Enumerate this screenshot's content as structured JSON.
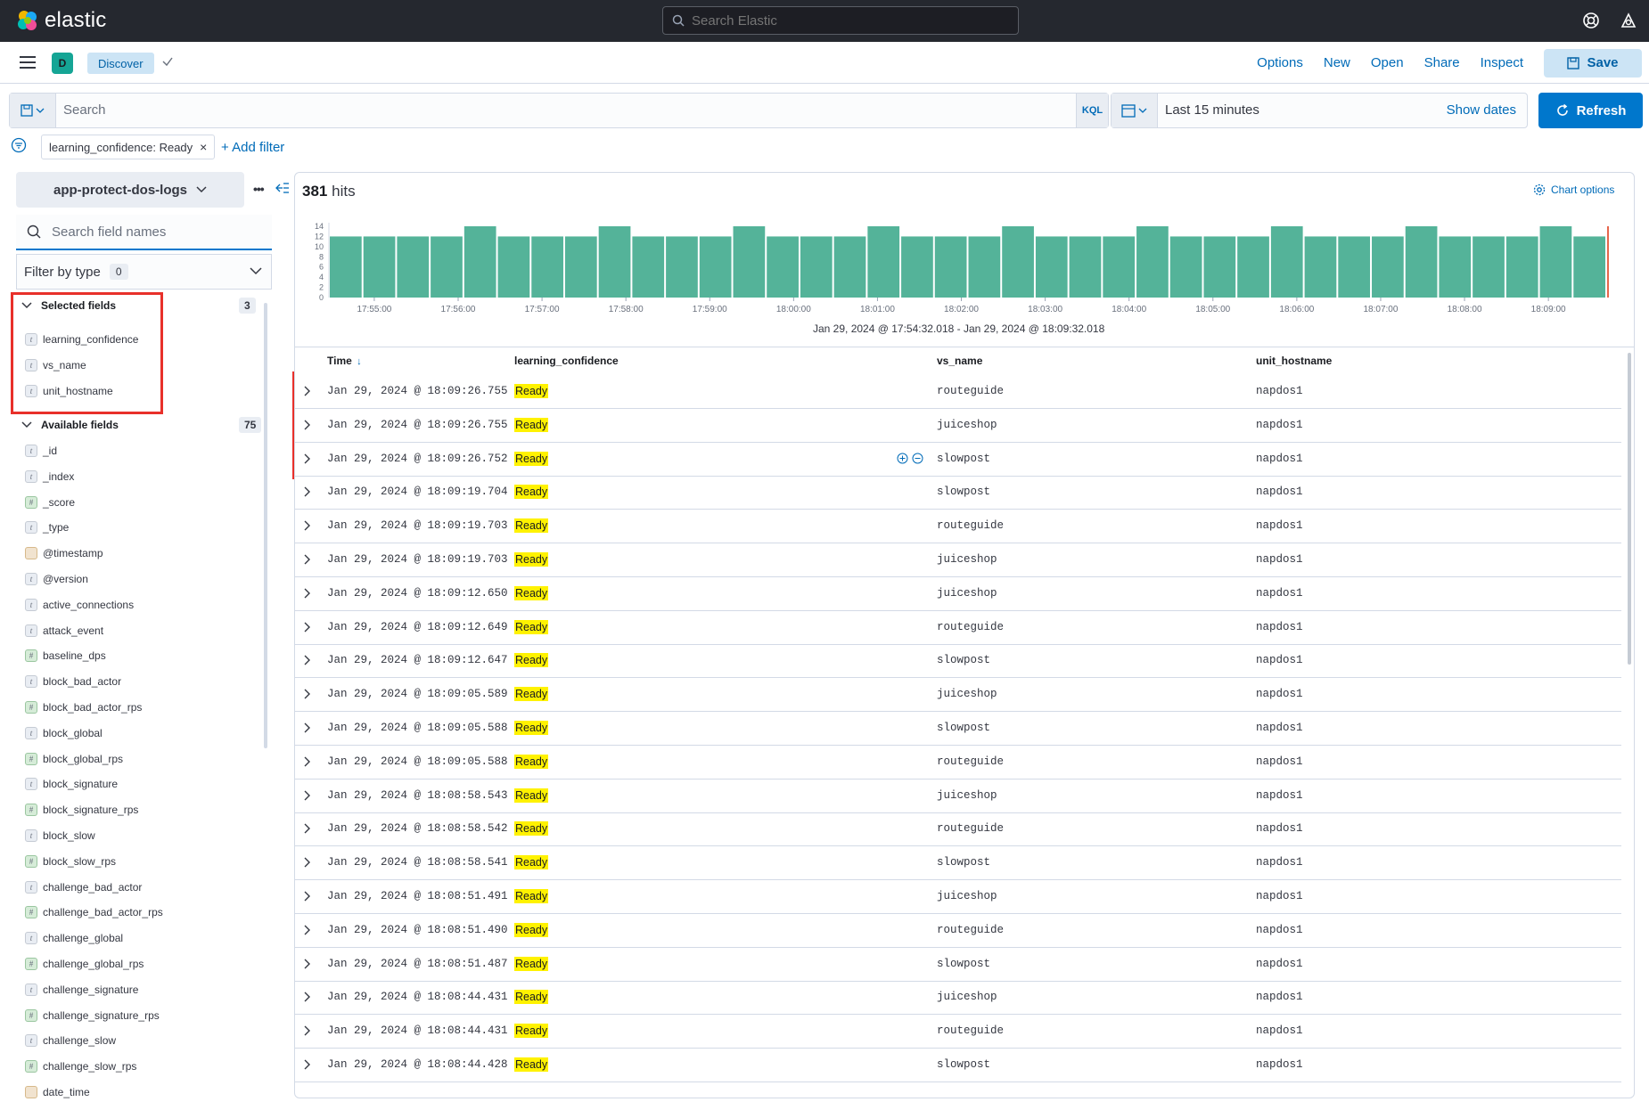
{
  "header": {
    "logo_text": "elastic",
    "search_placeholder": "Search Elastic"
  },
  "appbar": {
    "space_initial": "D",
    "breadcrumb": "Discover",
    "links": [
      "Options",
      "New",
      "Open",
      "Share",
      "Inspect"
    ],
    "save_label": "Save"
  },
  "query": {
    "placeholder": "Search",
    "language": "KQL",
    "time_range": "Last 15 minutes",
    "show_dates": "Show dates",
    "refresh_label": "Refresh"
  },
  "filters": {
    "pill": "learning_confidence: Ready",
    "add_filter": "+ Add filter"
  },
  "sidebar": {
    "index_pattern": "app-protect-dos-logs",
    "field_search_placeholder": "Search field names",
    "filter_by_type": "Filter by type",
    "filter_count": "0",
    "selected_title": "Selected fields",
    "selected_count": "3",
    "selected_fields": [
      {
        "type": "t",
        "name": "learning_confidence"
      },
      {
        "type": "t",
        "name": "vs_name"
      },
      {
        "type": "t",
        "name": "unit_hostname"
      }
    ],
    "available_title": "Available fields",
    "available_count": "75",
    "available_fields": [
      {
        "type": "t",
        "name": "_id"
      },
      {
        "type": "t",
        "name": "_index"
      },
      {
        "type": "#",
        "name": "_score"
      },
      {
        "type": "t",
        "name": "_type"
      },
      {
        "type": "date",
        "name": "@timestamp"
      },
      {
        "type": "t",
        "name": "@version"
      },
      {
        "type": "t",
        "name": "active_connections"
      },
      {
        "type": "t",
        "name": "attack_event"
      },
      {
        "type": "#",
        "name": "baseline_dps"
      },
      {
        "type": "t",
        "name": "block_bad_actor"
      },
      {
        "type": "#",
        "name": "block_bad_actor_rps"
      },
      {
        "type": "t",
        "name": "block_global"
      },
      {
        "type": "#",
        "name": "block_global_rps"
      },
      {
        "type": "t",
        "name": "block_signature"
      },
      {
        "type": "#",
        "name": "block_signature_rps"
      },
      {
        "type": "t",
        "name": "block_slow"
      },
      {
        "type": "#",
        "name": "block_slow_rps"
      },
      {
        "type": "t",
        "name": "challenge_bad_actor"
      },
      {
        "type": "#",
        "name": "challenge_bad_actor_rps"
      },
      {
        "type": "t",
        "name": "challenge_global"
      },
      {
        "type": "#",
        "name": "challenge_global_rps"
      },
      {
        "type": "t",
        "name": "challenge_signature"
      },
      {
        "type": "#",
        "name": "challenge_signature_rps"
      },
      {
        "type": "t",
        "name": "challenge_slow"
      },
      {
        "type": "#",
        "name": "challenge_slow_rps"
      },
      {
        "type": "date",
        "name": "date_time"
      }
    ]
  },
  "main": {
    "hits_count": "381",
    "hits_label": "hits",
    "chart_options": "Chart options",
    "range_text": "Jan 29, 2024 @ 17:54:32.018 - Jan 29, 2024 @ 18:09:32.018",
    "columns": [
      "Time",
      "learning_confidence",
      "vs_name",
      "unit_hostname"
    ],
    "rows": [
      {
        "time": "Jan 29, 2024 @ 18:09:26.755",
        "lc": "Ready",
        "vs": "routeguide",
        "host": "napdos1"
      },
      {
        "time": "Jan 29, 2024 @ 18:09:26.755",
        "lc": "Ready",
        "vs": "juiceshop",
        "host": "napdos1"
      },
      {
        "time": "Jan 29, 2024 @ 18:09:26.752",
        "lc": "Ready",
        "vs": "slowpost",
        "host": "napdos1"
      },
      {
        "time": "Jan 29, 2024 @ 18:09:19.704",
        "lc": "Ready",
        "vs": "slowpost",
        "host": "napdos1"
      },
      {
        "time": "Jan 29, 2024 @ 18:09:19.703",
        "lc": "Ready",
        "vs": "routeguide",
        "host": "napdos1"
      },
      {
        "time": "Jan 29, 2024 @ 18:09:19.703",
        "lc": "Ready",
        "vs": "juiceshop",
        "host": "napdos1"
      },
      {
        "time": "Jan 29, 2024 @ 18:09:12.650",
        "lc": "Ready",
        "vs": "juiceshop",
        "host": "napdos1"
      },
      {
        "time": "Jan 29, 2024 @ 18:09:12.649",
        "lc": "Ready",
        "vs": "routeguide",
        "host": "napdos1"
      },
      {
        "time": "Jan 29, 2024 @ 18:09:12.647",
        "lc": "Ready",
        "vs": "slowpost",
        "host": "napdos1"
      },
      {
        "time": "Jan 29, 2024 @ 18:09:05.589",
        "lc": "Ready",
        "vs": "juiceshop",
        "host": "napdos1"
      },
      {
        "time": "Jan 29, 2024 @ 18:09:05.588",
        "lc": "Ready",
        "vs": "slowpost",
        "host": "napdos1"
      },
      {
        "time": "Jan 29, 2024 @ 18:09:05.588",
        "lc": "Ready",
        "vs": "routeguide",
        "host": "napdos1"
      },
      {
        "time": "Jan 29, 2024 @ 18:08:58.543",
        "lc": "Ready",
        "vs": "juiceshop",
        "host": "napdos1"
      },
      {
        "time": "Jan 29, 2024 @ 18:08:58.542",
        "lc": "Ready",
        "vs": "routeguide",
        "host": "napdos1"
      },
      {
        "time": "Jan 29, 2024 @ 18:08:58.541",
        "lc": "Ready",
        "vs": "slowpost",
        "host": "napdos1"
      },
      {
        "time": "Jan 29, 2024 @ 18:08:51.491",
        "lc": "Ready",
        "vs": "juiceshop",
        "host": "napdos1"
      },
      {
        "time": "Jan 29, 2024 @ 18:08:51.490",
        "lc": "Ready",
        "vs": "routeguide",
        "host": "napdos1"
      },
      {
        "time": "Jan 29, 2024 @ 18:08:51.487",
        "lc": "Ready",
        "vs": "slowpost",
        "host": "napdos1"
      },
      {
        "time": "Jan 29, 2024 @ 18:08:44.431",
        "lc": "Ready",
        "vs": "juiceshop",
        "host": "napdos1"
      },
      {
        "time": "Jan 29, 2024 @ 18:08:44.431",
        "lc": "Ready",
        "vs": "routeguide",
        "host": "napdos1"
      },
      {
        "time": "Jan 29, 2024 @ 18:08:44.428",
        "lc": "Ready",
        "vs": "slowpost",
        "host": "napdos1"
      }
    ]
  },
  "chart_data": {
    "type": "bar",
    "title": "",
    "xlabel": "",
    "ylabel": "",
    "ylim": [
      0,
      14
    ],
    "yticks": [
      0,
      2,
      4,
      6,
      8,
      10,
      12,
      14
    ],
    "xtick_labels": [
      "17:55:00",
      "17:56:00",
      "17:57:00",
      "17:58:00",
      "17:59:00",
      "18:00:00",
      "18:01:00",
      "18:02:00",
      "18:03:00",
      "18:04:00",
      "18:05:00",
      "18:06:00",
      "18:07:00",
      "18:08:00",
      "18:09:00"
    ],
    "values": [
      12,
      12,
      12,
      12,
      14,
      12,
      12,
      12,
      14,
      12,
      12,
      12,
      14,
      12,
      12,
      12,
      14,
      12,
      12,
      12,
      14,
      12,
      12,
      12,
      14,
      12,
      12,
      12,
      14,
      12,
      12,
      12,
      14,
      12,
      12,
      12,
      14,
      12
    ],
    "color": "#54b399",
    "marker_color": "#e7664c"
  }
}
